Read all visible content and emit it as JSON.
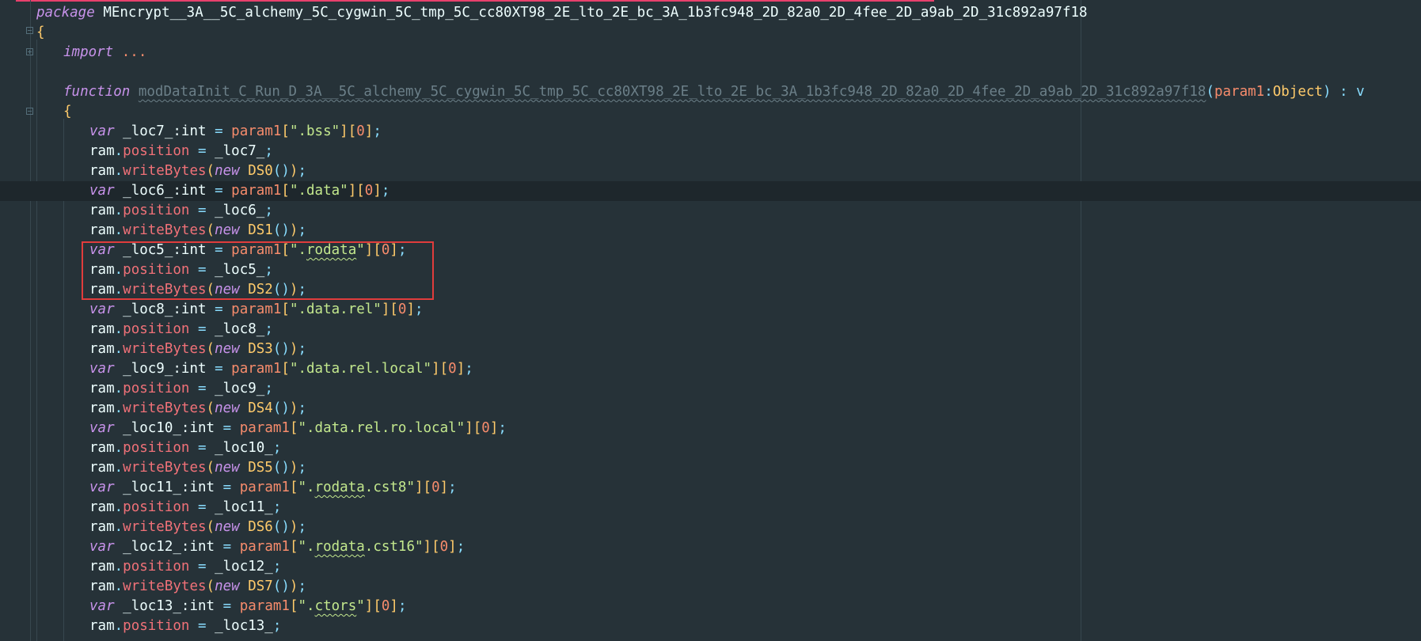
{
  "editor": {
    "package_line": {
      "keyword": "package",
      "name": "MEncrypt__3A__5C_alchemy_5C_cygwin_5C_tmp_5C_cc80XT98_2E_lto_2E_bc_3A_1b3fc948_2D_82a0_2D_4fee_2D_a9ab_2D_31c892a97f18"
    },
    "open_brace": "{",
    "import_line": {
      "keyword": "import",
      "ellipsis": "..."
    },
    "function_line": {
      "keyword": "function",
      "name": "modDataInit_C_Run_D_3A__5C_alchemy_5C_cygwin_5C_tmp_5C_cc80XT98_2E_lto_2E_bc_3A_1b3fc948_2D_82a0_2D_4fee_2D_a9ab_2D_31c892a97f18",
      "param": "param1",
      "param_type": "Object",
      "tail": ") : v"
    },
    "body_open": "{",
    "sections": [
      {
        "var": "_loc7_",
        "section": ".bss",
        "ds": "DS0"
      },
      {
        "var": "_loc6_",
        "section": ".data",
        "ds": "DS1"
      },
      {
        "var": "_loc5_",
        "section": ".rodata",
        "ds": "DS2"
      },
      {
        "var": "_loc8_",
        "section": ".data.rel",
        "ds": "DS3"
      },
      {
        "var": "_loc9_",
        "section": ".data.rel.local",
        "ds": "DS4"
      },
      {
        "var": "_loc10_",
        "section": ".data.rel.ro.local",
        "ds": "DS5"
      },
      {
        "var": "_loc11_",
        "section": ".rodata.cst8",
        "ds": "DS6"
      },
      {
        "var": "_loc12_",
        "section": ".rodata.cst16",
        "ds": "DS7"
      },
      {
        "var": "_loc13_",
        "section": ".ctors",
        "ds": ""
      }
    ],
    "tokens": {
      "var": "var",
      "int_type": ":int",
      "ram": "ram",
      "position": "position",
      "writeBytes": "writeBytes",
      "new": "new",
      "index_zero": "0"
    },
    "highlighted_section": ".rodata",
    "colors": {
      "background": "#263238",
      "keyword": "#c792ea",
      "property": "#f07178",
      "class": "#ffcb6b",
      "string": "#c3e88d",
      "number": "#f78c6c",
      "highlight_box": "#e03c3c"
    }
  }
}
